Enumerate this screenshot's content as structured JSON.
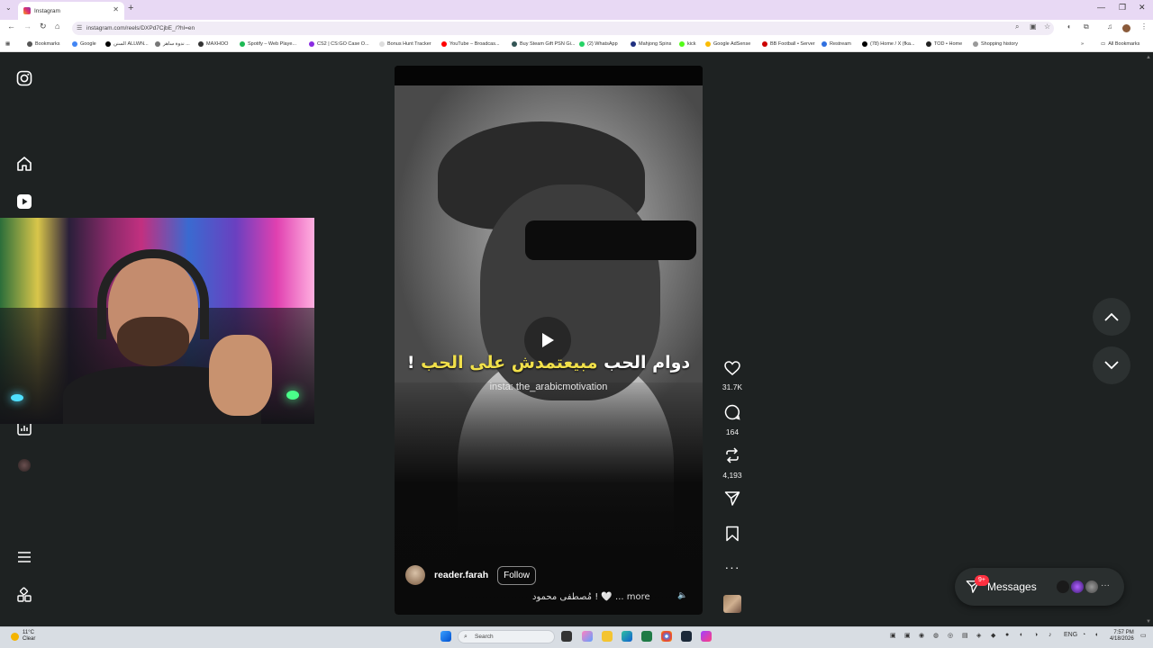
{
  "browser": {
    "tab_title": "Instagram",
    "url": "instagram.com/reels/DXPd7CjbE_/?hl=en",
    "new_tab": "+",
    "bookmarks": [
      {
        "label": "Bookmarks",
        "color": "#555"
      },
      {
        "label": "Google",
        "color": "#4285f4"
      },
      {
        "label": "السنن ALLWN...",
        "color": "#000"
      },
      {
        "label": "ندوة ساهر ...",
        "color": "#777"
      },
      {
        "label": "MAXHOO",
        "color": "#333"
      },
      {
        "label": "Spotify – Web Playe...",
        "color": "#1db954"
      },
      {
        "label": "CS2 | CS:GO Case O...",
        "color": "#8a2be2"
      },
      {
        "label": "Bonus Hunt Tracker",
        "color": "#ddd"
      },
      {
        "label": "YouTube – Broadcas...",
        "color": "#ff0000"
      },
      {
        "label": "Buy Steam Gift PSN Gi...",
        "color": "#355"
      },
      {
        "label": "(2) WhatsApp",
        "color": "#25d366"
      },
      {
        "label": "Mahjong Spins",
        "color": "#203080"
      },
      {
        "label": "kick",
        "color": "#53fc18"
      },
      {
        "label": "Google AdSense",
        "color": "#fbbc04"
      },
      {
        "label": "BB Football • Server",
        "color": "#c00"
      },
      {
        "label": "Restream",
        "color": "#3070e0"
      },
      {
        "label": "(78) Home / X (fka...",
        "color": "#000"
      },
      {
        "label": "TOD • Home",
        "color": "#222"
      },
      {
        "label": "Shopping history",
        "color": "#999"
      }
    ],
    "all_bookmarks": "All Bookmarks"
  },
  "caption": {
    "main_white_1": "دوام الحب",
    "main_yellow": "مبيعتمدش على الحب",
    "main_white_2": "!",
    "sub": "insta: the_arabicmotivation"
  },
  "reel": {
    "username": "reader.farah",
    "follow_label": "Follow",
    "description": "مُصطفى محمود ! 🤍 ... more"
  },
  "actions": {
    "likes": "31.7K",
    "comments": "164",
    "reposts": "4,193"
  },
  "messages": {
    "label": "Messages",
    "badge": "9+"
  },
  "taskbar": {
    "weather_temp": "11°C",
    "weather_desc": "Clear",
    "search_placeholder": "Search",
    "lang": "ENG",
    "time": "7:57 PM",
    "date": "4/18/2026"
  }
}
